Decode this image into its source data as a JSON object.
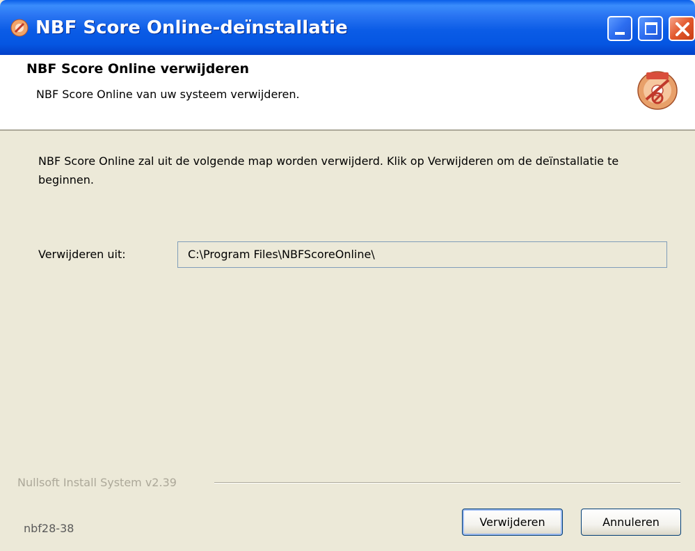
{
  "window": {
    "title": "NBF Score Online-deïnstallatie"
  },
  "header": {
    "title": "NBF Score Online verwijderen",
    "subtitle": "NBF Score Online van uw systeem verwijderen.",
    "icon": "uninstall-disc-icon"
  },
  "body": {
    "description": "NBF Score Online zal uit de volgende map worden verwijderd. Klik op Verwijderen om de deïnstallatie te beginnen.",
    "path_label": "Verwijderen uit:",
    "path_value": "C:\\Program Files\\NBFScoreOnline\\"
  },
  "footer": {
    "branding": "Nullsoft Install System v2.39",
    "label": "nbf28-38",
    "uninstall_button": "Verwijderen",
    "cancel_button": "Annuleren"
  },
  "colors": {
    "titlebar": "#0a5ee9",
    "dialog_bg": "#ece9d8",
    "close_button": "#e2582c"
  }
}
